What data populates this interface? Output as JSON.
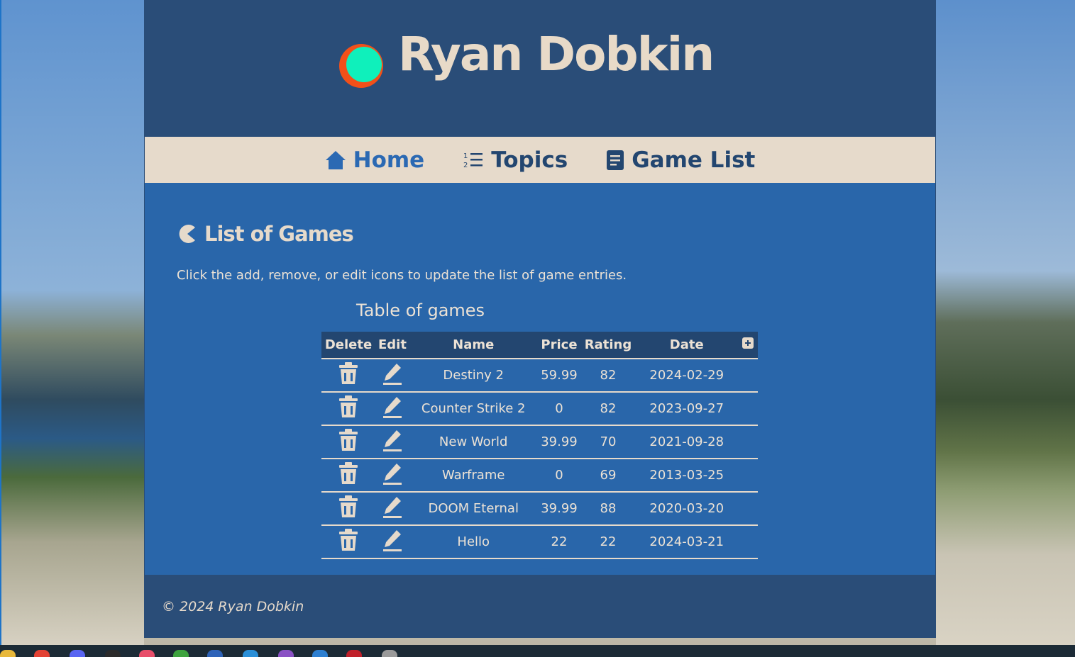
{
  "site": {
    "title": "Ryan Dobkin",
    "logo_colors": {
      "ring": "#f25019",
      "fill": "#0ff0bb"
    }
  },
  "nav": {
    "items": [
      {
        "label": "Home",
        "icon": "home-icon"
      },
      {
        "label": "Topics",
        "icon": "numbered-list-icon"
      },
      {
        "label": "Game List",
        "icon": "document-icon"
      }
    ]
  },
  "main": {
    "heading": "List of Games",
    "heading_icon": "pacman-icon",
    "intro": "Click the add, remove, or edit icons to update the list of game entries.",
    "table": {
      "caption": "Table of games",
      "columns": [
        "Delete",
        "Edit",
        "Name",
        "Price",
        "Rating",
        "Date"
      ],
      "add_icon": "plus-square-icon",
      "rows": [
        {
          "name": "Destiny 2",
          "price": "59.99",
          "rating": "82",
          "date": "2024-02-29"
        },
        {
          "name": "Counter Strike 2",
          "price": "0",
          "rating": "82",
          "date": "2023-09-27"
        },
        {
          "name": "New World",
          "price": "39.99",
          "rating": "70",
          "date": "2021-09-28"
        },
        {
          "name": "Warframe",
          "price": "0",
          "rating": "69",
          "date": "2013-03-25"
        },
        {
          "name": "DOOM Eternal",
          "price": "39.99",
          "rating": "88",
          "date": "2020-03-20"
        },
        {
          "name": "Hello",
          "price": "22",
          "rating": "22",
          "date": "2024-03-21"
        }
      ]
    }
  },
  "footer": {
    "copyright": "© 2024 Ryan Dobkin"
  },
  "colors": {
    "header_bg": "#2a4d78",
    "nav_bg": "#e6dacb",
    "main_bg": "#2966aa",
    "text_cream": "#e6dacb",
    "nav_active": "#2b69b3"
  }
}
